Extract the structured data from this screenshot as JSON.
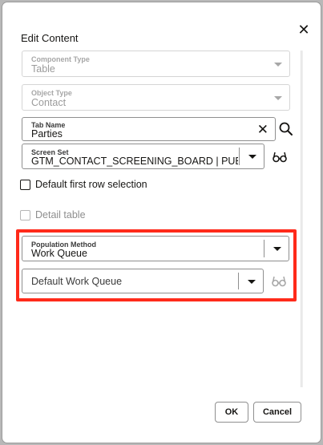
{
  "dialog": {
    "title": "Edit Content",
    "close_icon": "close-icon"
  },
  "component_type": {
    "label": "Component Type",
    "value": "Table"
  },
  "object_type": {
    "label": "Object Type",
    "value": "Contact"
  },
  "tab_name": {
    "label": "Tab Name",
    "value": "Parties",
    "clear_icon": "clear-icon",
    "search_icon": "search-icon"
  },
  "screen_set": {
    "label": "Screen Set",
    "value": "GTM_CONTACT_SCREENING_BOARD | PUB",
    "view_icon": "glasses-icon"
  },
  "default_first_row": {
    "label": "Default first row selection",
    "checked": false
  },
  "detail_table": {
    "label": "Detail table",
    "checked": false,
    "disabled": true
  },
  "population_method": {
    "label": "Population Method",
    "value": "Work Queue"
  },
  "default_work_queue": {
    "placeholder": "Default Work Queue",
    "view_icon": "glasses-icon"
  },
  "footer": {
    "ok_label": "OK",
    "cancel_label": "Cancel"
  },
  "colors": {
    "highlight": "#ff2a1a",
    "border": "#8f8f8f",
    "disabled": "#d5d5d5"
  }
}
